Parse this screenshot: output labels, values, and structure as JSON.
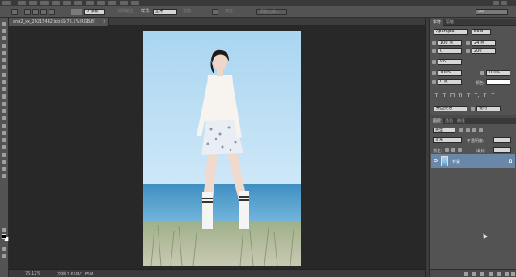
{
  "document": {
    "tab_title": "ang2_xx_20215482.jpg @ 75.1%(RGB/8)",
    "close_glyph": "×"
  },
  "options_bar": {
    "feather_value": "0 像素",
    "antialias_label": "消除锯齿",
    "style_label": "样式:",
    "style_value": "正常",
    "width_label": "宽度:",
    "height_label": "高度:",
    "refine_edge_button": "调整边缘...",
    "workspace_value": "3D"
  },
  "character_panel": {
    "tabs": [
      "字符",
      "段落"
    ],
    "font_family": "Aparajita",
    "font_style": "Bold",
    "font_size": "100 点",
    "leading": "24 点",
    "kerning": "0",
    "tracking": "200",
    "baseline_scale": "0%",
    "vertical_scale": "100%",
    "horizontal_scale": "100%",
    "baseline_shift": "0 点",
    "color_label": "颜色:",
    "color_swatch": "#ffffff",
    "style_buttons": [
      "T",
      "T",
      "TT",
      "Tr",
      "T",
      "T,",
      "T",
      "T"
    ],
    "language": "美国英语",
    "antialias": "锐利"
  },
  "layers_panel": {
    "tabs": [
      "图层",
      "通道",
      "路径"
    ],
    "kind_filter": "类型",
    "blend_mode": "正常",
    "opacity_label": "不透明度:",
    "lock_label": "锁定:",
    "fill_label": "填充:",
    "layers": [
      {
        "name": "背景",
        "visible": true,
        "locked": true,
        "selected": true
      }
    ]
  },
  "status_bar": {
    "zoom": "75.12%",
    "doc_size": "文档:1.65M/1.65M"
  },
  "colors": {
    "foreground": "#000000",
    "background": "#ffffff",
    "selection_accent": "#6a86a8"
  }
}
